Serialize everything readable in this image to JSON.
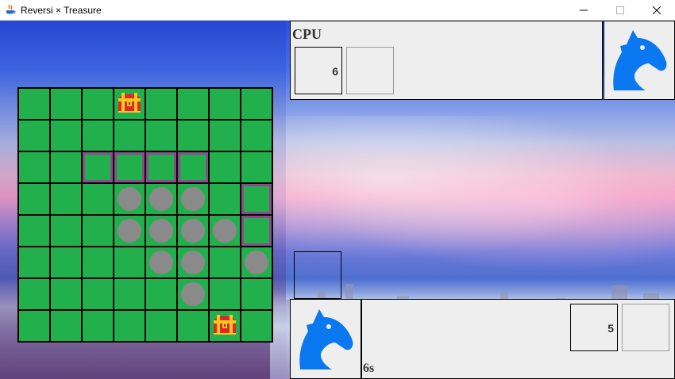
{
  "window": {
    "title": "Reversi × Treasure",
    "controls": [
      "minimize",
      "maximize",
      "close"
    ]
  },
  "board": {
    "size": 8,
    "cells": [
      [
        "",
        "",
        "",
        "T",
        "",
        "",
        "",
        ""
      ],
      [
        "",
        "",
        "",
        "",
        "",
        "",
        "",
        ""
      ],
      [
        "",
        "",
        "H",
        "H",
        "H",
        "H",
        "",
        ""
      ],
      [
        "",
        "",
        "",
        "D",
        "D",
        "D",
        "",
        "H"
      ],
      [
        "",
        "",
        "",
        "D",
        "D",
        "D",
        "D",
        "H"
      ],
      [
        "",
        "",
        "",
        "",
        "D",
        "D",
        "",
        "D"
      ],
      [
        "",
        "",
        "",
        "",
        "",
        "D",
        "",
        ""
      ],
      [
        "",
        "",
        "",
        "",
        "",
        "",
        "T",
        ""
      ]
    ],
    "legend": {
      "D": "gray disc",
      "H": "purple highlighted cell",
      "T": "treasure chest"
    }
  },
  "cpu": {
    "name": "CPU",
    "score": "6",
    "second_box": "",
    "avatar_icon": "knight-icon"
  },
  "player": {
    "avatar_icon": "knight-icon",
    "score": "5",
    "second_box": "",
    "timer": "6s"
  },
  "colors": {
    "board_green": "#22b04d",
    "disc_gray": "#8a8a8a",
    "hint_purple": "#8b4c8e",
    "knight_blue": "#0a78f0",
    "panel_gray": "#eeeeee"
  }
}
